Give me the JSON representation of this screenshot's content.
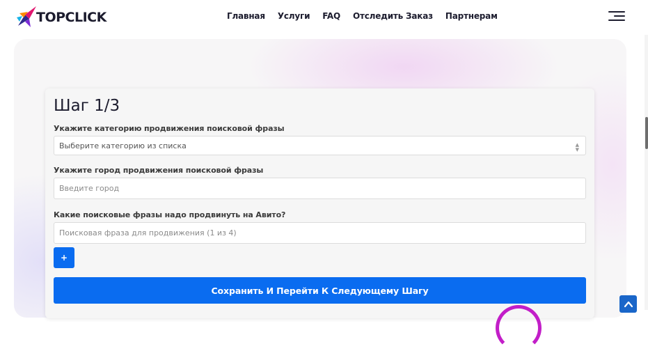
{
  "brand": {
    "name": "TOPCLICK"
  },
  "nav": {
    "items": [
      {
        "label": "Главная"
      },
      {
        "label": "Услуги"
      },
      {
        "label": "FAQ"
      },
      {
        "label": "Отследить Заказ"
      },
      {
        "label": "Партнерам"
      }
    ]
  },
  "form": {
    "step_title": "Шаг 1/3",
    "category_label": "Укажите категорию продвижения поисковой фразы",
    "category_selected": "Выберите категорию из списка",
    "city_label": "Укажите город продвижения поисковой фразы",
    "city_placeholder": "Введите город",
    "phrases_label": "Какие поисковые фразы надо продвинуть на Авито?",
    "phrase_placeholder": "Поисковая фраза для продвижения (1 из 4)",
    "add_label": "+",
    "submit_label": "Сохранить И Перейти К Следующему Шагу"
  },
  "icons": {
    "logo": "rocket-logo-icon",
    "menu": "hamburger-menu-icon",
    "select": "select-arrows-icon",
    "to_top": "chevron-up-icon"
  },
  "colors": {
    "primary": "#0a6cf0",
    "accent_pink": "#c21ec8",
    "to_top": "#1a66c9",
    "text_dark": "#1c1c2e"
  }
}
